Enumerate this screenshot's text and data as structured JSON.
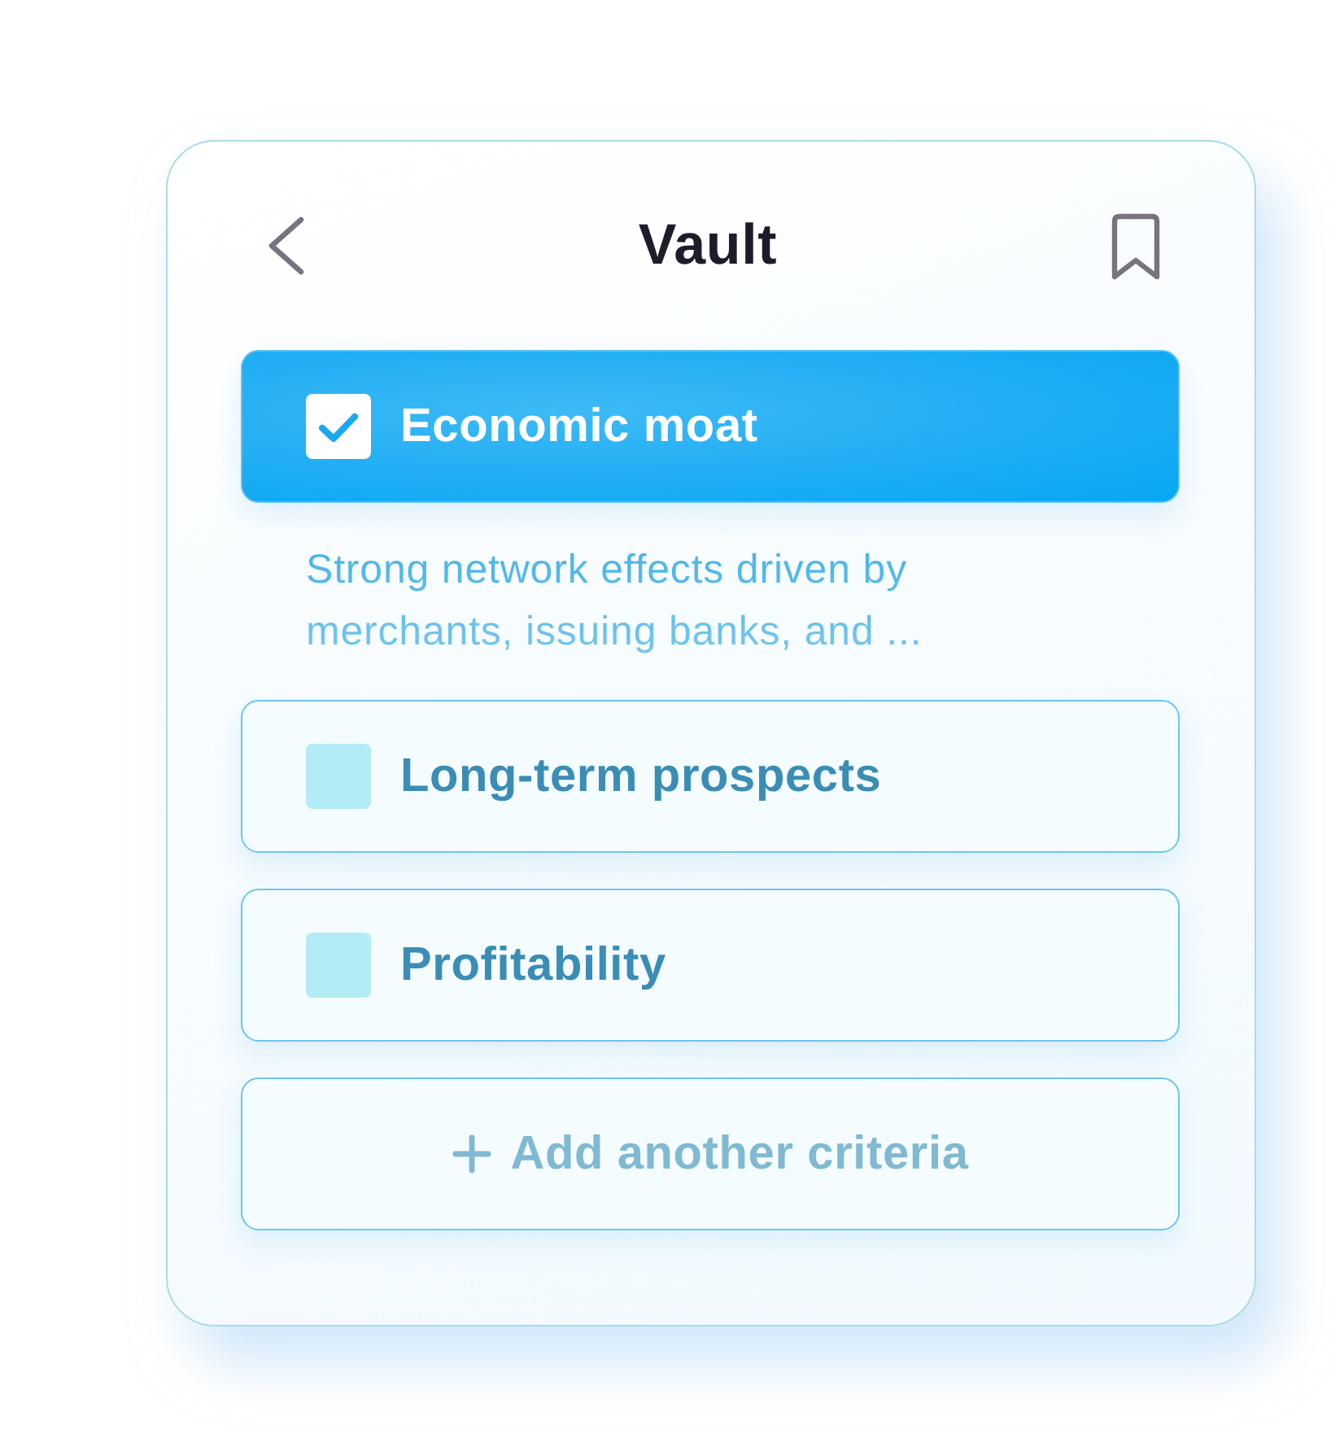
{
  "header": {
    "title": "Vault"
  },
  "criteria": [
    {
      "label": "Economic moat",
      "checked": true,
      "description": "Strong network effects driven by merchants, issuing banks, and ..."
    },
    {
      "label": "Long-term prospects",
      "checked": false
    },
    {
      "label": "Profitability",
      "checked": false
    }
  ],
  "add_button": {
    "label": "Add another criteria"
  }
}
